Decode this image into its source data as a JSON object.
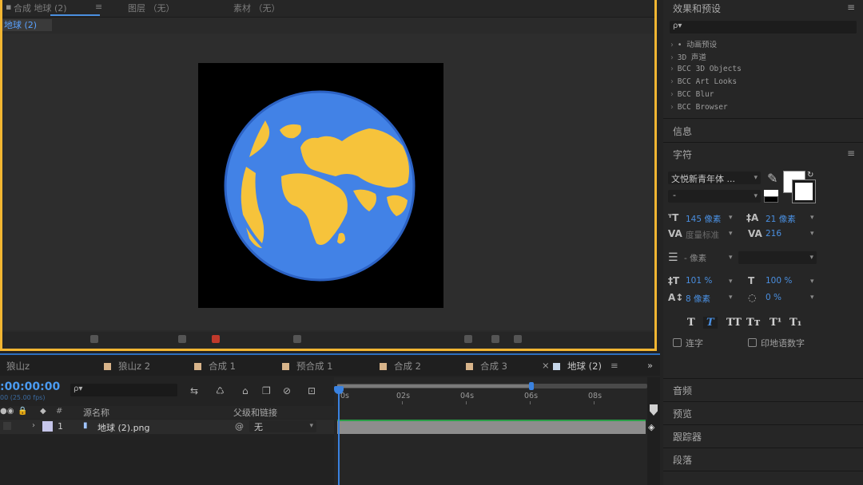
{
  "composition": {
    "tabs": [
      {
        "label": "合成 地球 (2)",
        "active": true
      },
      {
        "label": "图层 （无）",
        "active": false
      },
      {
        "label": "素材 （无）",
        "active": false
      }
    ],
    "menu_glyph": "≡",
    "breadcrumb": "地球 (2)"
  },
  "effects": {
    "title": "效果和预设",
    "search_icon": "ρ▾",
    "items": [
      "• 动画预设",
      "3D 声道",
      "BCC 3D Objects",
      "BCC Art Looks",
      "BCC Blur",
      "BCC Browser"
    ]
  },
  "info_panel": {
    "title": "信息"
  },
  "character": {
    "title": "字符",
    "font_family": "文悦新青年体 ...",
    "font_style": "-",
    "font_size": "145 像素",
    "leading": "21 像素",
    "kerning": "度量标准",
    "tracking": "216",
    "stroke_width": "- 像素",
    "vertical_scale": "101 %",
    "horizontal_scale": "100 %",
    "baseline_shift": "8 像素",
    "tsume": "0 %",
    "typo_buttons": [
      "T",
      "T",
      "TT",
      "Tт",
      "T¹",
      "T₁"
    ],
    "ligatures": "连字",
    "hindi_digits": "印地语数字",
    "fill_color": "#ffffff",
    "stroke_color": "#ffffff"
  },
  "collapsed_panels": [
    "音频",
    "预览",
    "跟踪器",
    "段落"
  ],
  "timeline": {
    "tabs": [
      {
        "label": "狼山z",
        "active": false
      },
      {
        "label": "狼山z 2",
        "active": false
      },
      {
        "label": "合成 1",
        "active": false
      },
      {
        "label": "预合成 1",
        "active": false
      },
      {
        "label": "合成 2",
        "active": false
      },
      {
        "label": "合成 3",
        "active": false
      },
      {
        "label": "地球 (2)",
        "active": true
      }
    ],
    "close_glyph": "×",
    "menu_glyph": "≡",
    "overflow_glyph": "»",
    "timecode": ":00:00:00",
    "timecode_sub": "00 (25.00 fps)",
    "search_icon": "ρ▾",
    "col_source_name": "源名称",
    "col_parent": "父级和链接",
    "col_hash": "#",
    "layer": {
      "number": "1",
      "name": "地球 (2).png",
      "parent": "无"
    },
    "ruler_labels": [
      "0s",
      "02s",
      "04s",
      "06s",
      "08s"
    ]
  },
  "colors": {
    "accent_blue": "#4a8fe0",
    "highlight_yellow": "#f2b632",
    "earth_ocean": "#4282e6",
    "earth_land": "#f6c33b"
  }
}
